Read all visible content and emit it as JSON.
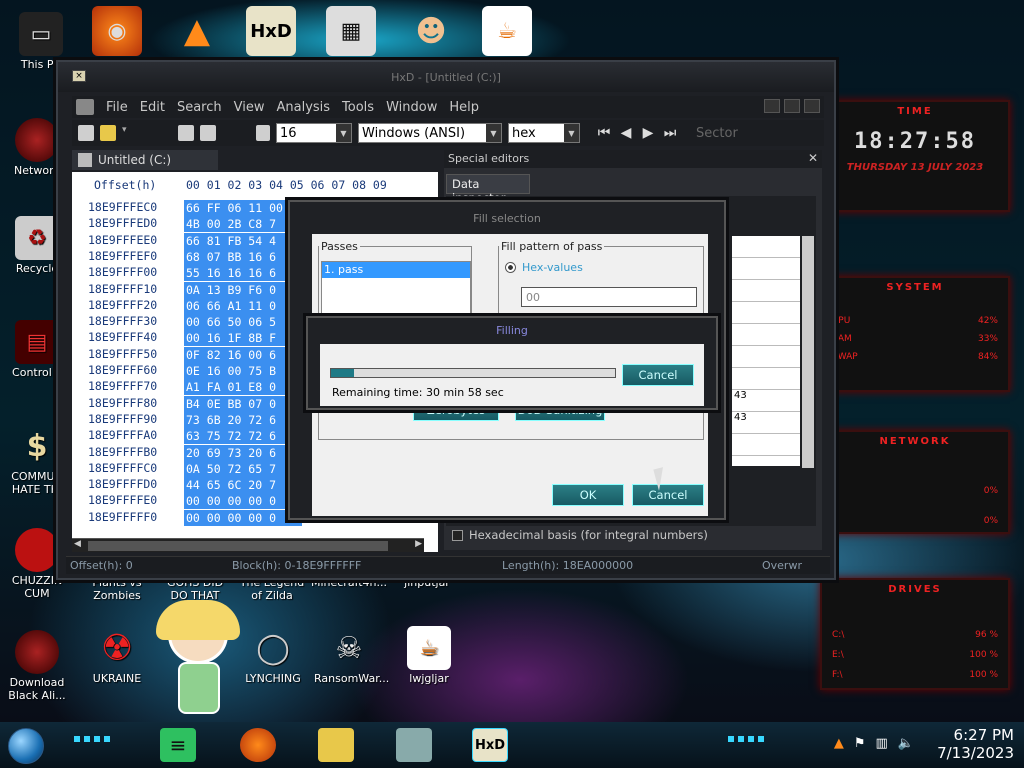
{
  "desktop": {
    "top_icons": [
      {
        "label": "This PC"
      },
      {
        "label": ""
      },
      {
        "label": ""
      },
      {
        "label": ""
      },
      {
        "label": ""
      },
      {
        "label": ""
      },
      {
        "label": ""
      }
    ],
    "left_icons": [
      {
        "label": "Network"
      },
      {
        "label": "Recycle"
      },
      {
        "label": "Control P"
      },
      {
        "label": "COMMUN HATE THI"
      },
      {
        "label": "CHUZZIN CUM"
      },
      {
        "label": "Download Black Ali..."
      }
    ],
    "row_icons_behind": [
      "Plants vs Zombies",
      "GOHS DID DO THAT",
      "The Legend of Zilda",
      "Minecraft4n...",
      "jinputjar"
    ],
    "bottom_icons": [
      "UKRAINE",
      "LYNCHING",
      "RansomWar...",
      "lwjgljar"
    ]
  },
  "hxd": {
    "title": "HxD - [Untitled (C:)]",
    "sys_glyph": "×",
    "menu": [
      "File",
      "Edit",
      "Search",
      "View",
      "Analysis",
      "Tools",
      "Window",
      "Help"
    ],
    "toolbar": {
      "bytes_per_row": "16",
      "charset": "Windows (ANSI)",
      "display": "hex",
      "sector_label": "Sector"
    },
    "file_tab": "Untitled (C:)",
    "hex_header": {
      "offset_label": "Offset(h)",
      "columns": "00 01 02 03 04 05 06 07 08 09"
    },
    "rows": [
      {
        "addr": "18E9FFFEC0",
        "bytes": "66 FF 06 11 00"
      },
      {
        "addr": "18E9FFFED0",
        "bytes": "4B 00 2B C8 7"
      },
      {
        "addr": "18E9FFFEE0",
        "bytes": "66 81 FB 54 4"
      },
      {
        "addr": "18E9FFFEF0",
        "bytes": "68 07 BB 16 6"
      },
      {
        "addr": "18E9FFFF00",
        "bytes": "55 16 16 16 6"
      },
      {
        "addr": "18E9FFFF10",
        "bytes": "0A 13 B9 F6 0"
      },
      {
        "addr": "18E9FFFF20",
        "bytes": "06 66 A1 11 0"
      },
      {
        "addr": "18E9FFFF30",
        "bytes": "00 66 50 06 5"
      },
      {
        "addr": "18E9FFFF40",
        "bytes": "00 16 1F 8B F"
      },
      {
        "addr": "18E9FFFF50",
        "bytes": "0F 82 16 00 6"
      },
      {
        "addr": "18E9FFFF60",
        "bytes": "0E 16 00 75 B"
      },
      {
        "addr": "18E9FFFF70",
        "bytes": "A1 FA 01 E8 0"
      },
      {
        "addr": "18E9FFFF80",
        "bytes": "B4 0E BB 07 0"
      },
      {
        "addr": "18E9FFFF90",
        "bytes": "73 6B 20 72 6"
      },
      {
        "addr": "18E9FFFFA0",
        "bytes": "63 75 72 72 6"
      },
      {
        "addr": "18E9FFFFB0",
        "bytes": "20 69 73 20 6"
      },
      {
        "addr": "18E9FFFFC0",
        "bytes": "0A 50 72 65 7"
      },
      {
        "addr": "18E9FFFFD0",
        "bytes": "44 65 6C 20 7"
      },
      {
        "addr": "18E9FFFFE0",
        "bytes": "00 00 00 00 0"
      },
      {
        "addr": "18E9FFFFF0",
        "bytes": "00 00 00 00 0"
      }
    ],
    "special_editors": {
      "title": "Special editors",
      "tab": "Data inspector",
      "grid_tail": [
        "",
        "",
        "",
        "",
        "",
        "",
        "",
        "43",
        "43",
        ""
      ],
      "checkbox_label": "Hexadecimal basis (for integral numbers)"
    },
    "status": {
      "offset": "Offset(h): 0",
      "block": "Block(h): 0-18E9FFFFFF",
      "length": "Length(h): 18EA000000",
      "mode": "Overwr"
    }
  },
  "fill_dialog": {
    "title": "Fill selection",
    "passes_legend": "Passes",
    "pass_item": "1. pass",
    "pattern_legend": "Fill pattern of pass",
    "radio_label": "Hex-values",
    "hex_value": "00",
    "zerobytes_label": "Zerobytes",
    "dod_label": "DoD Sanitizing",
    "ok_label": "OK",
    "cancel_label": "Cancel"
  },
  "progress_dialog": {
    "title": "Filling",
    "remaining": "Remaining time: 30 min 58 sec",
    "cancel_label": "Cancel",
    "progress_fraction": 0.08
  },
  "gadget": {
    "time_title": "TIME",
    "clock": "18:27:58",
    "date": "THURSDAY 13 JULY 2023",
    "system_title": "SYSTEM",
    "system_rows": [
      [
        "CPU",
        "42%"
      ],
      [
        "RAM",
        "33%"
      ],
      [
        "SWAP",
        "84%"
      ]
    ],
    "network_title": "NETWORK",
    "network_rows": [
      [
        "",
        "0%"
      ],
      [
        "",
        "0%"
      ]
    ],
    "drives_title": "DRIVES",
    "drive_rows": [
      [
        "C:\\",
        "96 %"
      ],
      [
        "E:\\",
        "100 %"
      ],
      [
        "F:\\",
        "100 %"
      ]
    ]
  },
  "taskbar": {
    "time": "6:27 PM",
    "date": "7/13/2023"
  },
  "colors": {
    "accent_cyan": "#38d8ff",
    "selection_blue": "#3b8ff0",
    "alien_red": "#e22222"
  }
}
